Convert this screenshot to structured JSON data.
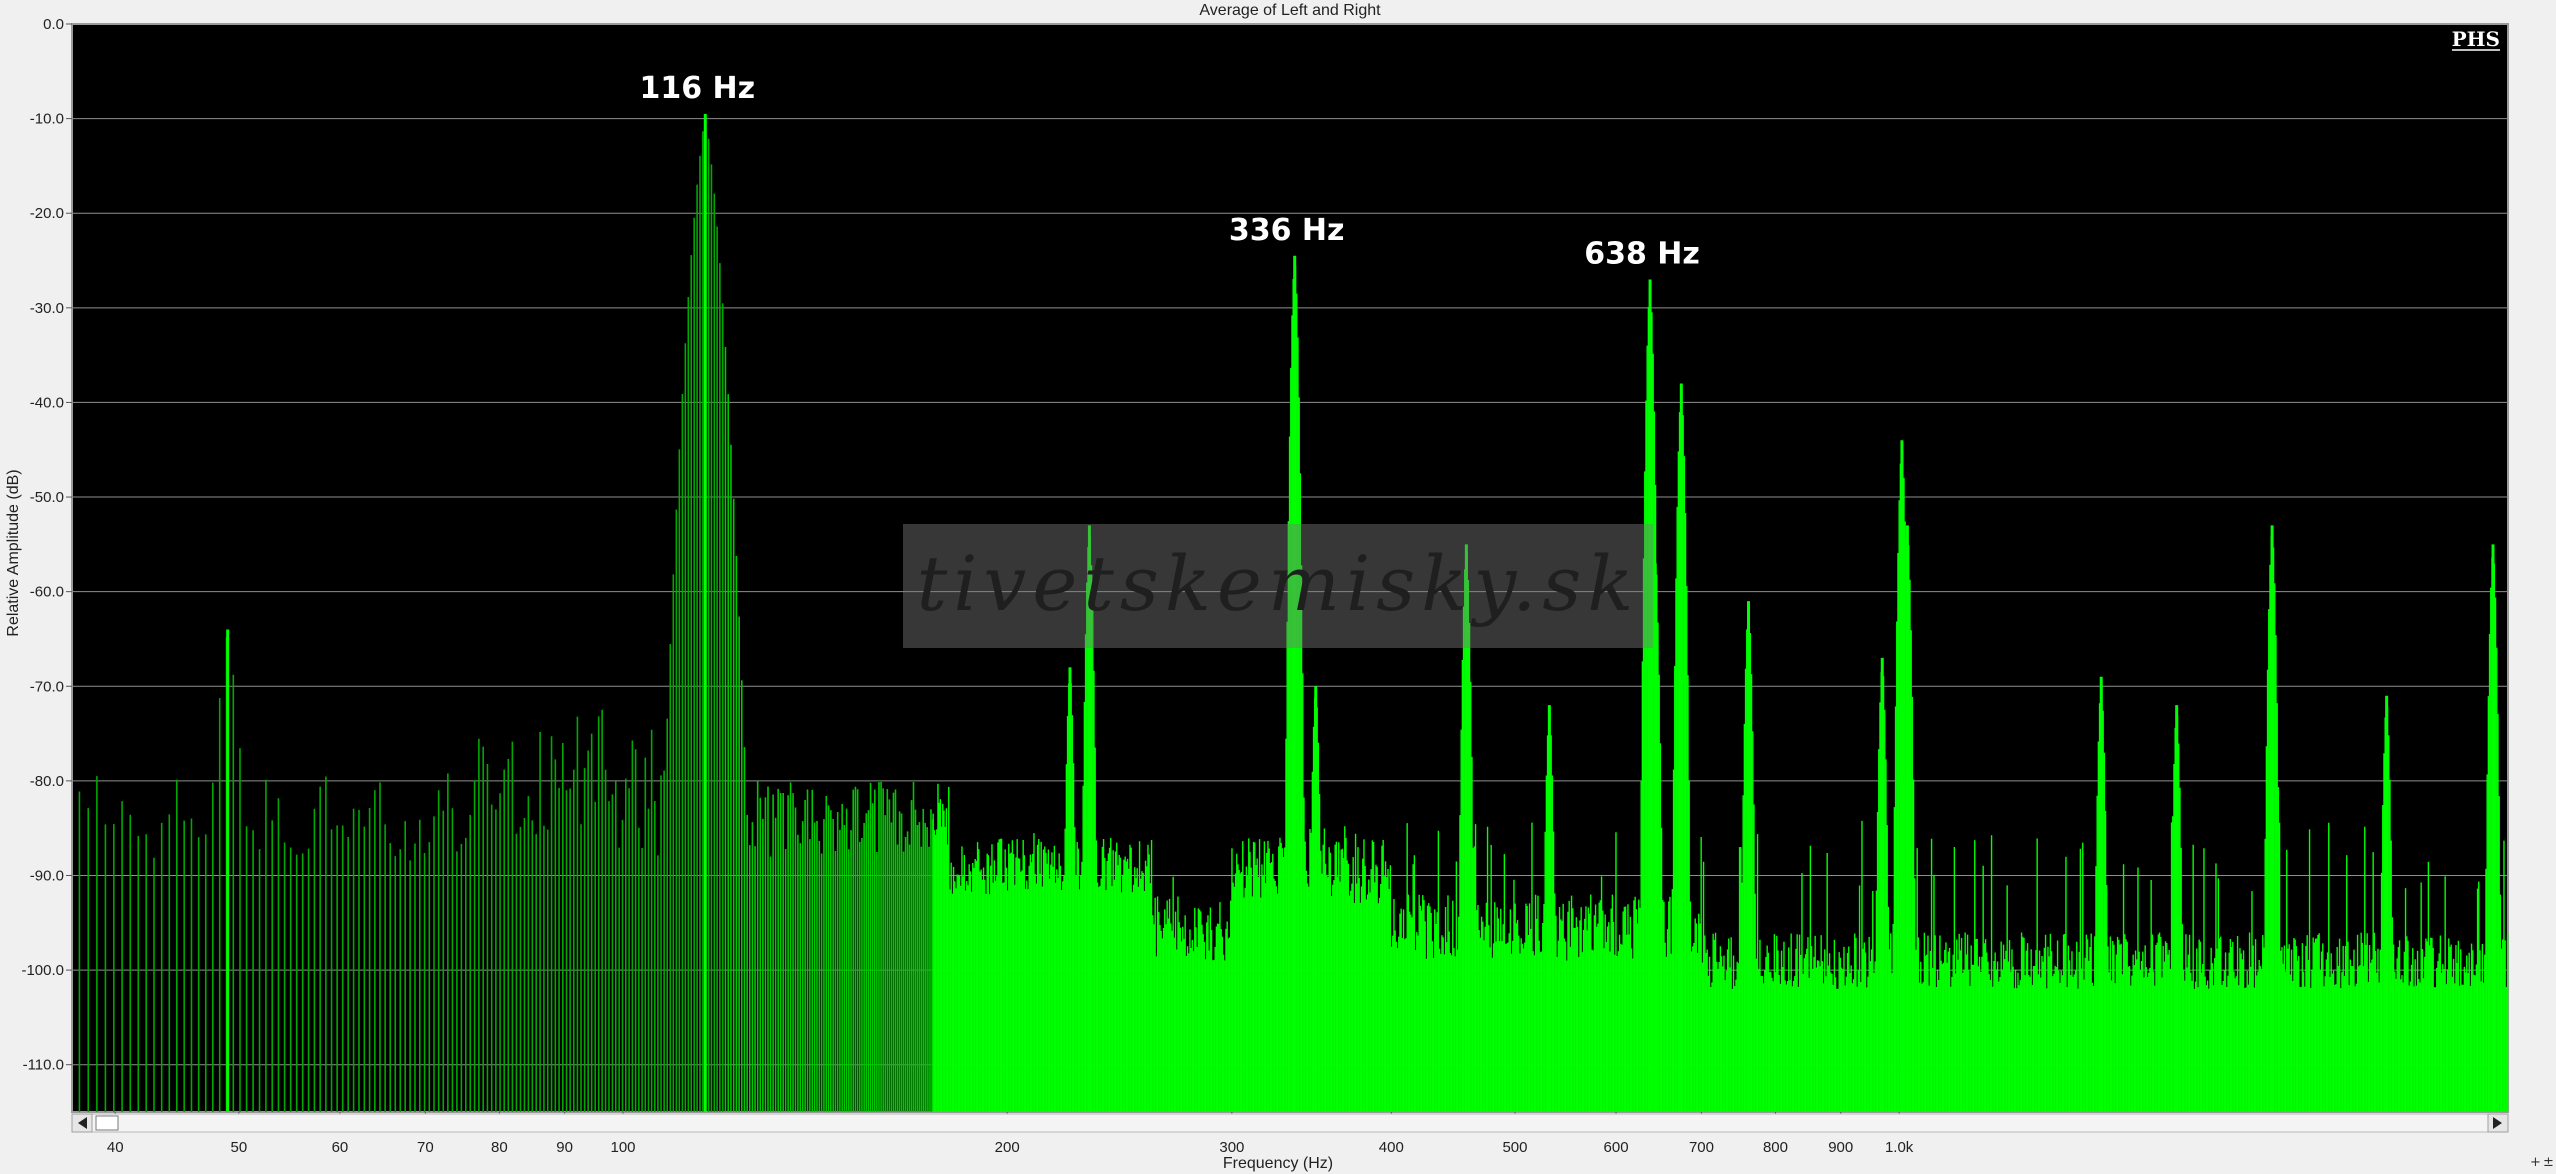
{
  "chart_data": {
    "type": "line",
    "title": "Average of Left and Right",
    "xlabel": "Frequency (Hz)",
    "ylabel": "Relative Amplitude (dB)",
    "xscale": "log",
    "xlim": [
      37,
      3000
    ],
    "ylim": [
      -115,
      0
    ],
    "grid": "horizontal",
    "background": "#000000",
    "series_color": "#00ff00",
    "y_ticks": [
      {
        "value": 0,
        "label": "0.0"
      },
      {
        "value": -10,
        "label": "-10.0"
      },
      {
        "value": -20,
        "label": "-20.0"
      },
      {
        "value": -30,
        "label": "-30.0"
      },
      {
        "value": -40,
        "label": "-40.0"
      },
      {
        "value": -50,
        "label": "-50.0"
      },
      {
        "value": -60,
        "label": "-60.0"
      },
      {
        "value": -70,
        "label": "-70.0"
      },
      {
        "value": -80,
        "label": "-80.0"
      },
      {
        "value": -90,
        "label": "-90.0"
      },
      {
        "value": -100,
        "label": "-100.0"
      },
      {
        "value": -110,
        "label": "-110.0"
      }
    ],
    "x_ticks": [
      {
        "value": 40,
        "label": "40"
      },
      {
        "value": 50,
        "label": "50"
      },
      {
        "value": 60,
        "label": "60"
      },
      {
        "value": 70,
        "label": "70"
      },
      {
        "value": 80,
        "label": "80"
      },
      {
        "value": 90,
        "label": "90"
      },
      {
        "value": 100,
        "label": "100"
      },
      {
        "value": 200,
        "label": "200"
      },
      {
        "value": 300,
        "label": "300"
      },
      {
        "value": 400,
        "label": "400"
      },
      {
        "value": 500,
        "label": "500"
      },
      {
        "value": 600,
        "label": "600"
      },
      {
        "value": 700,
        "label": "700"
      },
      {
        "value": 800,
        "label": "800"
      },
      {
        "value": 900,
        "label": "900"
      },
      {
        "value": 1000,
        "label": "1.0k"
      }
    ],
    "peaks": [
      {
        "x": 116,
        "y": -9.5
      },
      {
        "x": 336,
        "y": -24.5
      },
      {
        "x": 638,
        "y": -27
      }
    ],
    "annotations": [
      {
        "x": 116,
        "text": "116 Hz"
      },
      {
        "x": 336,
        "text": "336 Hz"
      },
      {
        "x": 638,
        "text": "638 Hz"
      }
    ],
    "minor_peaks": [
      {
        "x": 49,
        "y": -64
      },
      {
        "x": 224,
        "y": -68
      },
      {
        "x": 232,
        "y": -53
      },
      {
        "x": 349,
        "y": -70
      },
      {
        "x": 458,
        "y": -55
      },
      {
        "x": 532,
        "y": -72
      },
      {
        "x": 644,
        "y": -57
      },
      {
        "x": 675,
        "y": -38
      },
      {
        "x": 762,
        "y": -61
      },
      {
        "x": 970,
        "y": -67
      },
      {
        "x": 1005,
        "y": -44
      },
      {
        "x": 1015,
        "y": -53
      },
      {
        "x": 1440,
        "y": -69
      },
      {
        "x": 1650,
        "y": -72
      },
      {
        "x": 1960,
        "y": -53
      },
      {
        "x": 2410,
        "y": -71
      },
      {
        "x": 2920,
        "y": -55
      }
    ]
  },
  "watermark": "tivetskemisky.sk",
  "logo": "PHS"
}
